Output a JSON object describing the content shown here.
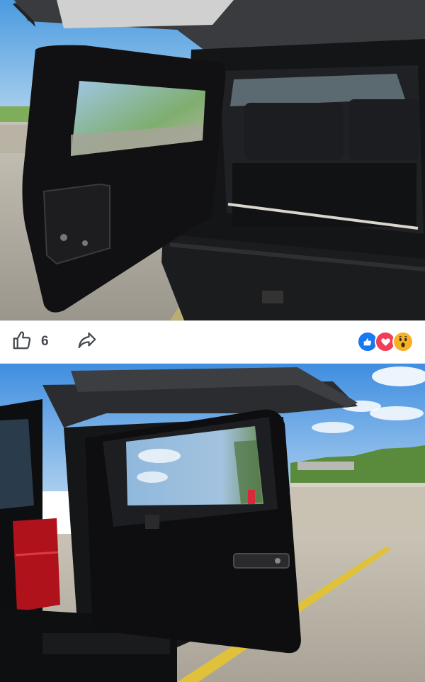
{
  "post": {
    "photos": [
      {
        "name": "rear-door-open-interior-view"
      },
      {
        "name": "rear-door-open-side-view"
      }
    ],
    "actions": {
      "like_count": "6",
      "like_icon": "thumbs-up-icon",
      "share_icon": "share-arrow-icon"
    },
    "reactions": [
      {
        "type": "like",
        "icon": "like-reaction-icon",
        "color": "#1877f2"
      },
      {
        "type": "love",
        "icon": "love-reaction-icon",
        "color": "#f33e58"
      },
      {
        "type": "wow",
        "icon": "wow-reaction-icon",
        "color": "#f7b125"
      }
    ]
  }
}
